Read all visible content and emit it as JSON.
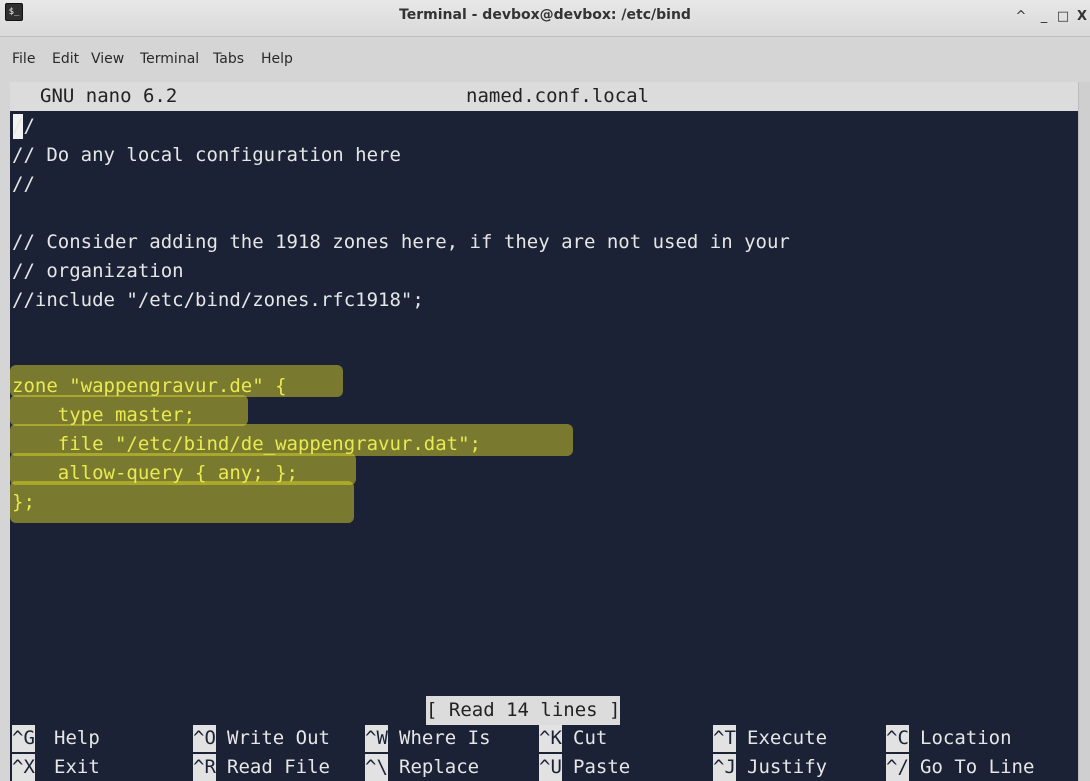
{
  "window": {
    "title": "Terminal - devbox@devbox: /etc/bind",
    "app_icon_glyph": "$_",
    "controls": {
      "maximize": "^",
      "minimize": "_",
      "restore": "□",
      "close": "X"
    }
  },
  "menubar": [
    "File",
    "Edit",
    "View",
    "Terminal",
    "Tabs",
    "Help"
  ],
  "nano": {
    "version": "GNU nano 6.2",
    "filename": "named.conf.local",
    "lines": [
      "//",
      "// Do any local configuration here",
      "//",
      "",
      "// Consider adding the 1918 zones here, if they are not used in your",
      "// organization",
      "//include \"/etc/bind/zones.rfc1918\";",
      "",
      "",
      "zone \"wappengravur.de\" {",
      "    type master;",
      "    file \"/etc/bind/de_wappengravur.dat\";",
      "    allow-query { any; };",
      "};"
    ],
    "status": "[ Read 14 lines ]",
    "shortcuts_row1": [
      {
        "key": "^G",
        "label": "Help"
      },
      {
        "key": "^O",
        "label": "Write Out"
      },
      {
        "key": "^W",
        "label": "Where Is"
      },
      {
        "key": "^K",
        "label": "Cut"
      },
      {
        "key": "^T",
        "label": "Execute"
      },
      {
        "key": "^C",
        "label": "Location"
      }
    ],
    "shortcuts_row2": [
      {
        "key": "^X",
        "label": "Exit"
      },
      {
        "key": "^R",
        "label": "Read File"
      },
      {
        "key": "^\\",
        "label": "Replace"
      },
      {
        "key": "^U",
        "label": "Paste"
      },
      {
        "key": "^J",
        "label": "Justify"
      },
      {
        "key": "^/",
        "label": "Go To Line"
      }
    ]
  },
  "colors": {
    "terminal_bg": "#1b2236",
    "text": "#e6e6e6",
    "highlight_text": "#eaea52",
    "highlight_marker": "#e0dc28",
    "bar_bg": "#dcdcdc"
  }
}
